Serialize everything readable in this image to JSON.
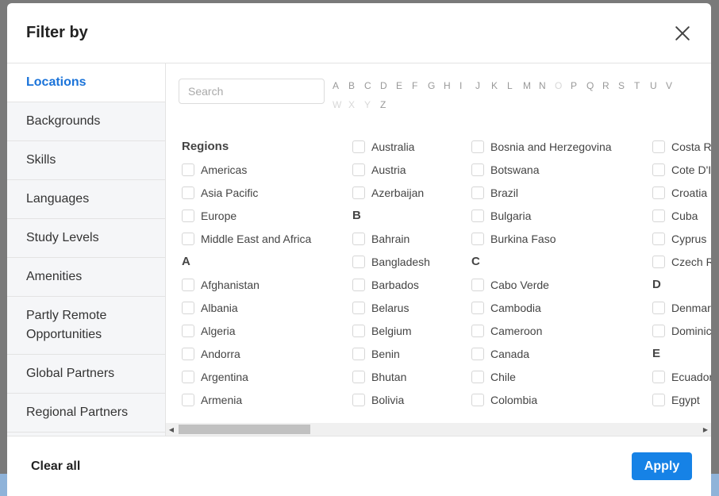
{
  "modal": {
    "title": "Filter by",
    "clear_label": "Clear all",
    "apply_label": "Apply"
  },
  "sidebar": {
    "items": [
      {
        "label": "Locations",
        "active": true
      },
      {
        "label": "Backgrounds"
      },
      {
        "label": "Skills"
      },
      {
        "label": "Languages"
      },
      {
        "label": "Study Levels"
      },
      {
        "label": "Amenities"
      },
      {
        "label": "Partly Remote Opportunities"
      },
      {
        "label": "Global Partners"
      },
      {
        "label": "Regional Partners"
      }
    ]
  },
  "search": {
    "placeholder": "Search",
    "value": ""
  },
  "alphabet": [
    {
      "letter": "A",
      "enabled": true
    },
    {
      "letter": "B",
      "enabled": true
    },
    {
      "letter": "C",
      "enabled": true
    },
    {
      "letter": "D",
      "enabled": true
    },
    {
      "letter": "E",
      "enabled": true
    },
    {
      "letter": "F",
      "enabled": true
    },
    {
      "letter": "G",
      "enabled": true
    },
    {
      "letter": "H",
      "enabled": true
    },
    {
      "letter": "I",
      "enabled": true
    },
    {
      "letter": "J",
      "enabled": true
    },
    {
      "letter": "K",
      "enabled": true
    },
    {
      "letter": "L",
      "enabled": true
    },
    {
      "letter": "M",
      "enabled": true
    },
    {
      "letter": "N",
      "enabled": true
    },
    {
      "letter": "O",
      "enabled": false
    },
    {
      "letter": "P",
      "enabled": true
    },
    {
      "letter": "Q",
      "enabled": true
    },
    {
      "letter": "R",
      "enabled": true
    },
    {
      "letter": "S",
      "enabled": true
    },
    {
      "letter": "T",
      "enabled": true
    },
    {
      "letter": "U",
      "enabled": true
    },
    {
      "letter": "V",
      "enabled": true
    },
    {
      "letter": "W",
      "enabled": false
    },
    {
      "letter": "X",
      "enabled": false
    },
    {
      "letter": "Y",
      "enabled": false
    },
    {
      "letter": "Z",
      "enabled": true
    }
  ],
  "columns": [
    [
      {
        "type": "heading",
        "text": "Regions"
      },
      {
        "type": "option",
        "text": "Americas"
      },
      {
        "type": "option",
        "text": "Asia Pacific"
      },
      {
        "type": "option",
        "text": "Europe"
      },
      {
        "type": "option",
        "text": "Middle East and Africa"
      },
      {
        "type": "heading",
        "text": "A"
      },
      {
        "type": "option",
        "text": "Afghanistan"
      },
      {
        "type": "option",
        "text": "Albania"
      },
      {
        "type": "option",
        "text": "Algeria"
      },
      {
        "type": "option",
        "text": "Andorra"
      },
      {
        "type": "option",
        "text": "Argentina"
      },
      {
        "type": "option",
        "text": "Armenia"
      }
    ],
    [
      {
        "type": "option",
        "text": "Australia"
      },
      {
        "type": "option",
        "text": "Austria"
      },
      {
        "type": "option",
        "text": "Azerbaijan"
      },
      {
        "type": "heading",
        "text": "B"
      },
      {
        "type": "option",
        "text": "Bahrain"
      },
      {
        "type": "option",
        "text": "Bangladesh"
      },
      {
        "type": "option",
        "text": "Barbados"
      },
      {
        "type": "option",
        "text": "Belarus"
      },
      {
        "type": "option",
        "text": "Belgium"
      },
      {
        "type": "option",
        "text": "Benin"
      },
      {
        "type": "option",
        "text": "Bhutan"
      },
      {
        "type": "option",
        "text": "Bolivia"
      }
    ],
    [
      {
        "type": "option",
        "text": "Bosnia and Herzegovina"
      },
      {
        "type": "option",
        "text": "Botswana"
      },
      {
        "type": "option",
        "text": "Brazil"
      },
      {
        "type": "option",
        "text": "Bulgaria"
      },
      {
        "type": "option",
        "text": "Burkina Faso"
      },
      {
        "type": "heading",
        "text": "C"
      },
      {
        "type": "option",
        "text": "Cabo Verde"
      },
      {
        "type": "option",
        "text": "Cambodia"
      },
      {
        "type": "option",
        "text": "Cameroon"
      },
      {
        "type": "option",
        "text": "Canada"
      },
      {
        "type": "option",
        "text": "Chile"
      },
      {
        "type": "option",
        "text": "Colombia"
      }
    ],
    [
      {
        "type": "option",
        "text": "Costa R"
      },
      {
        "type": "option",
        "text": "Cote D'I"
      },
      {
        "type": "option",
        "text": "Croatia"
      },
      {
        "type": "option",
        "text": "Cuba"
      },
      {
        "type": "option",
        "text": "Cyprus"
      },
      {
        "type": "option",
        "text": "Czech R"
      },
      {
        "type": "heading",
        "text": "D"
      },
      {
        "type": "option",
        "text": "Denmar"
      },
      {
        "type": "option",
        "text": "Dominic"
      },
      {
        "type": "heading",
        "text": "E"
      },
      {
        "type": "option",
        "text": "Ecuador"
      },
      {
        "type": "option",
        "text": "Egypt"
      }
    ]
  ]
}
